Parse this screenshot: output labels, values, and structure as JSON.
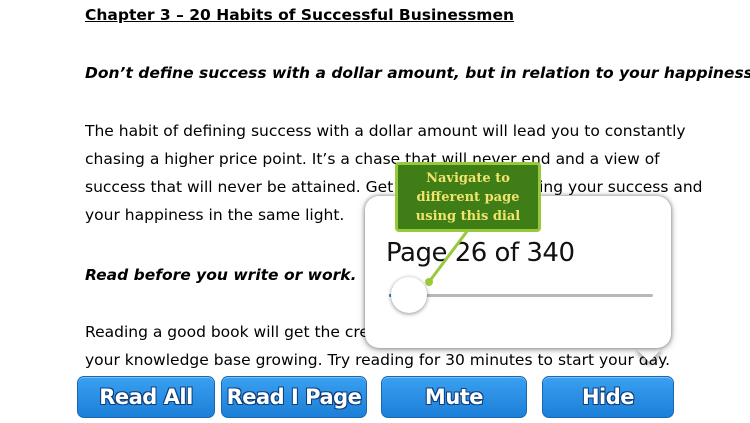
{
  "document": {
    "chapter_title": "Chapter 3 – 20 Habits of Successful Businessmen",
    "subheading_1": "Don’t define success with a dollar amount, but in relation to your happiness.",
    "paragraph_1": [
      "The habit of defining success with a dollar amount will lead you to constantly",
      "chasing a higher price point. It’s a chase that will never end and a view of",
      "success that will never be attained. Get in the habit of seeing your success and",
      "your happiness in the same light."
    ],
    "subheading_2": "Read before you write or work.",
    "paragraph_2": [
      "Reading a good book will get the creative juices flowing and keep",
      "your knowledge base growing. Try reading for 30 minutes to start your day."
    ]
  },
  "dial": {
    "page_label": "Page 26 of 340",
    "current_page": 26,
    "total_pages": 340,
    "progress": 0.076
  },
  "tooltip": {
    "text": "Navigate to different page using this dial"
  },
  "buttons": {
    "read_all": "Read All",
    "read_page": "Read I Page",
    "mute": "Mute",
    "hide": "Hide"
  },
  "colors": {
    "button_blue": "#2a8fe6",
    "tooltip_green": "#3f7d17",
    "tooltip_text": "#f1e36c",
    "slider_fill": "#2f7bdf"
  }
}
